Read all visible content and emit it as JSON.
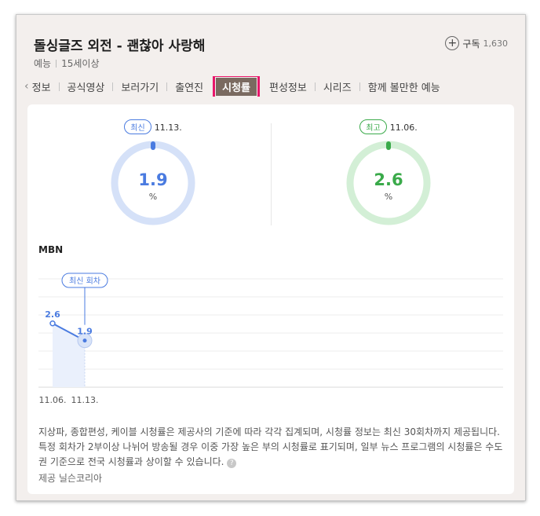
{
  "header": {
    "title": "돌싱글즈 외전 - 괜찮아 사랑해",
    "genre": "예능",
    "rating": "15세이상",
    "subscribe_label": "구독",
    "subscribe_count": "1,630"
  },
  "tabs": [
    {
      "label": "정보"
    },
    {
      "label": "공식영상"
    },
    {
      "label": "보러가기"
    },
    {
      "label": "출연진"
    },
    {
      "label": "시청률"
    },
    {
      "label": "편성정보"
    },
    {
      "label": "시리즈"
    },
    {
      "label": "함께 볼만한 예능"
    }
  ],
  "active_tab": "시청률",
  "gauges": {
    "latest": {
      "badge": "최신",
      "date": "11.13.",
      "value": "1.9",
      "unit": "%",
      "color": "#4a7be0",
      "track": "#d5e1f8"
    },
    "best": {
      "badge": "최고",
      "date": "11.06.",
      "value": "2.6",
      "unit": "%",
      "color": "#3aaa4a",
      "track": "#d3efd6"
    }
  },
  "channel": "MBN",
  "chart_data": {
    "type": "line",
    "x": [
      "11.06.",
      "11.13."
    ],
    "y": [
      2.6,
      1.9
    ],
    "data_labels": [
      "2.6",
      "1.9"
    ],
    "annotation": "최신 회차",
    "color": "#4a7be0"
  },
  "notice": "지상파, 종합편성, 케이블 시청률은 제공사의 기준에 따라 각각 집계되며, 시청률 정보는 최신 30회차까지 제공됩니다. 특정 회차가 2부이상 나뉘어 방송될 경우 이중 가장 높은 부의 시청률로 표기되며, 일부 뉴스 프로그램의 시청률은 수도권 기준으로 전국 시청률과 상이할 수 있습니다.",
  "provider": "제공 닐슨코리아"
}
